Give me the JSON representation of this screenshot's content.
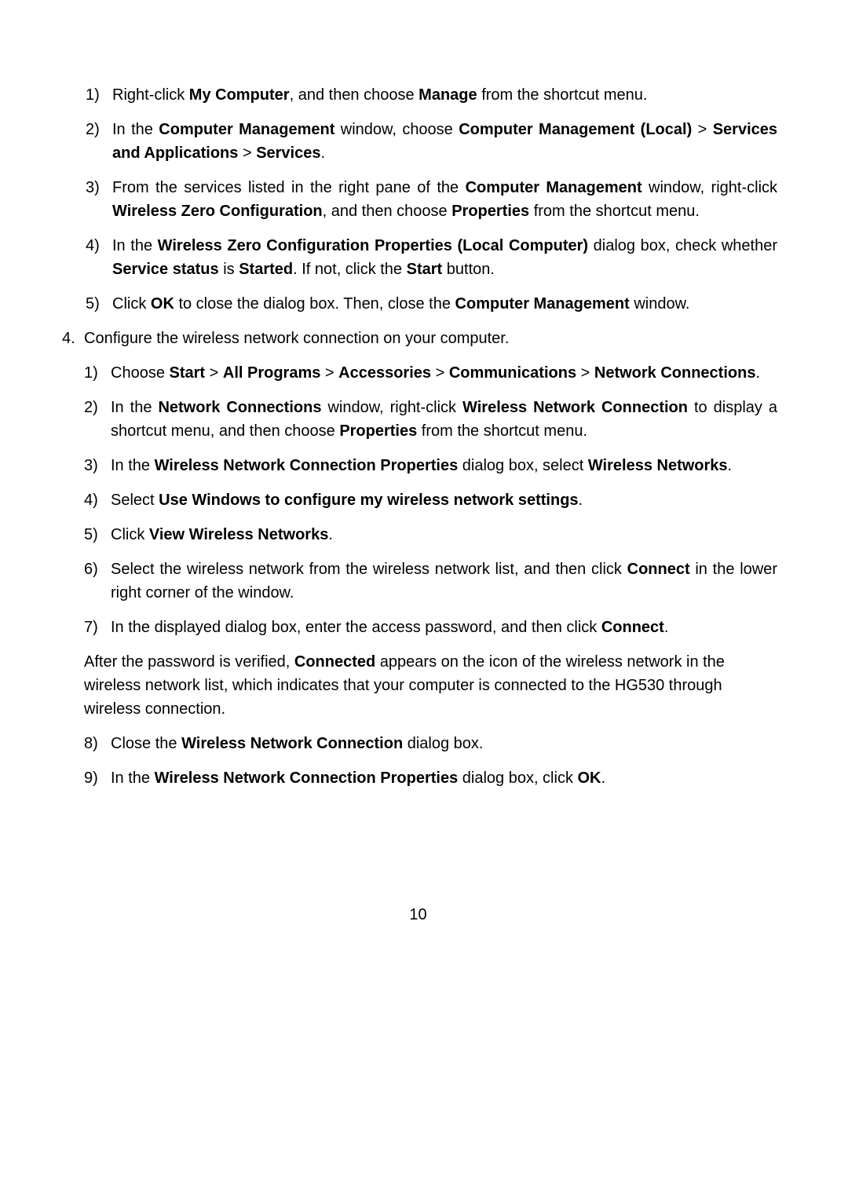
{
  "pageNumber": "10",
  "section": {
    "item4Text": "Configure the wireless network connection on your computer.",
    "sub3": {
      "s1": {
        "t1": "Right-click ",
        "b1": "My Computer",
        "t2": ", and then choose ",
        "b2": "Manage",
        "t3": " from the shortcut menu."
      },
      "s2": {
        "t1": "In the ",
        "b1": "Computer Management",
        "t2": " window, choose ",
        "b2": "Computer Management (Local)",
        "t3": " > ",
        "b3": "Services and Applications",
        "t4": " > ",
        "b4": "Services",
        "t5": "."
      },
      "s3": {
        "t1": "From the services listed in the right pane of the ",
        "b1": "Computer Management",
        "t2": " window, right-click ",
        "b2": "Wireless Zero Configuration",
        "t3": ", and then choose ",
        "b3": "Properties",
        "t4": " from the shortcut menu."
      },
      "s4": {
        "t1": "In the ",
        "b1": "Wireless Zero Configuration Properties (Local Computer)",
        "t2": " dialog box, check whether ",
        "b2": "Service status",
        "t3": " is ",
        "b3": "Started",
        "t4": ". If not, click the ",
        "b4": "Start",
        "t5": " button."
      },
      "s5": {
        "t1": "Click ",
        "b1": "OK",
        "t2": " to close the dialog box. Then, close the ",
        "b2": "Computer Management",
        "t3": " window."
      }
    },
    "sub4": {
      "s1": {
        "t1": "Choose ",
        "b1": "Start",
        "t2": " > ",
        "b2": "All Programs",
        "t3": " > ",
        "b3": "Accessories",
        "t4": " > ",
        "b4": "Communications",
        "t5": " > ",
        "b5": "Network Connections",
        "t6": "."
      },
      "s2": {
        "t1": "In the ",
        "b1": "Network Connections",
        "t2": " window, right-click ",
        "b2": "Wireless Network Connection",
        "t3": " to display a shortcut menu, and then choose ",
        "b3": "Properties",
        "t4": " from the shortcut menu."
      },
      "s3": {
        "t1": "In the ",
        "b1": "Wireless Network Connection Properties",
        "t2": " dialog box, select ",
        "b2": "Wireless Networks",
        "t3": "."
      },
      "s4": {
        "t1": "Select ",
        "b1": "Use Windows to configure my wireless network settings",
        "t2": "."
      },
      "s5": {
        "t1": "Click ",
        "b1": "View Wireless Networks",
        "t2": "."
      },
      "s6": {
        "t1": "Select the wireless network from the wireless network list, and then click ",
        "b1": "Connect",
        "t2": " in the lower right corner of the window."
      },
      "s7": {
        "t1": "In the displayed dialog box, enter the access password, and then click ",
        "b1": "Connect",
        "t2": "."
      },
      "afterPara": {
        "t1": "After the password is verified, ",
        "b1": "Connected",
        "t2": " appears on the icon of the wireless network in the wireless network list, which indicates that your computer is connected to the HG530 through wireless connection."
      },
      "s8": {
        "t1": "Close the ",
        "b1": "Wireless Network Connection",
        "t2": " dialog box."
      },
      "s9": {
        "t1": "In the ",
        "b1": "Wireless Network Connection Properties",
        "t2": " dialog box, click ",
        "b2": "OK",
        "t3": "."
      }
    }
  },
  "markers": {
    "m4": "4.",
    "p1": "1)",
    "p2": "2)",
    "p3": "3)",
    "p4": "4)",
    "p5": "5)",
    "p6": "6)",
    "p7": "7)",
    "p8": "8)",
    "p9": "9)"
  }
}
